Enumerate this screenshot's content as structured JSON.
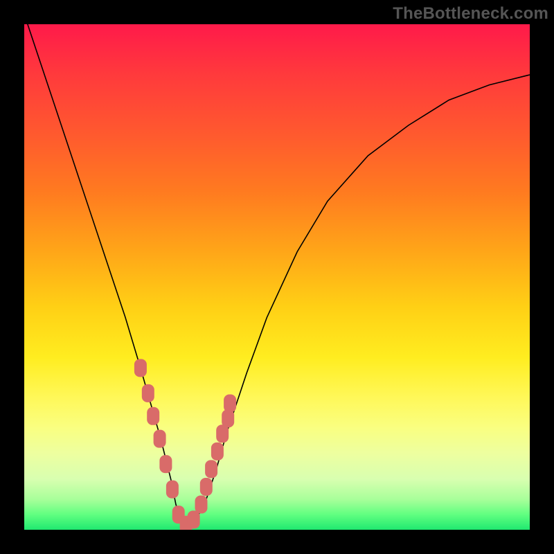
{
  "branding": {
    "text": "TheBottleneck.com"
  },
  "chart_data": {
    "type": "line",
    "title": "",
    "xlabel": "",
    "ylabel": "",
    "xlim": [
      0,
      100
    ],
    "ylim": [
      0,
      100
    ],
    "series": [
      {
        "name": "bottleneck-curve",
        "x": [
          0,
          5,
          10,
          15,
          20,
          23,
          25,
          27,
          29,
          30,
          31,
          32,
          33,
          34,
          36,
          38,
          40,
          44,
          48,
          54,
          60,
          68,
          76,
          84,
          92,
          100
        ],
        "values": [
          102,
          87,
          72,
          57,
          42,
          32,
          25,
          18,
          10,
          5,
          2,
          1,
          1,
          2,
          6,
          12,
          19,
          31,
          42,
          55,
          65,
          74,
          80,
          85,
          88,
          90
        ]
      }
    ],
    "markers": {
      "name": "highlighted-points",
      "shape": "rounded-rect",
      "color": "#d96b69",
      "x": [
        23.0,
        24.5,
        25.5,
        26.8,
        28.0,
        29.3,
        30.5,
        32.0,
        33.5,
        35.0,
        36.0,
        37.0,
        38.2,
        39.2,
        40.3,
        40.7
      ],
      "values": [
        32.0,
        27.0,
        22.5,
        18.0,
        13.0,
        8.0,
        3.0,
        1.0,
        2.0,
        5.0,
        8.5,
        12.0,
        15.5,
        19.0,
        22.0,
        25.0
      ]
    },
    "background_gradient": {
      "top": "#ff1a4a",
      "bottom": "#20e870"
    }
  }
}
